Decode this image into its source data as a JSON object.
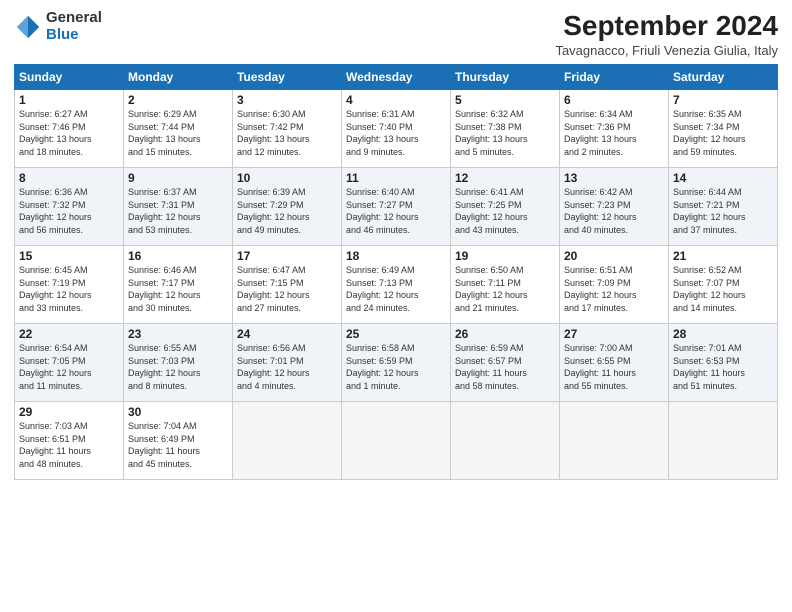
{
  "header": {
    "logo_general": "General",
    "logo_blue": "Blue",
    "month_title": "September 2024",
    "location": "Tavagnacco, Friuli Venezia Giulia, Italy"
  },
  "weekdays": [
    "Sunday",
    "Monday",
    "Tuesday",
    "Wednesday",
    "Thursday",
    "Friday",
    "Saturday"
  ],
  "weeks": [
    [
      {
        "day": "1",
        "info": "Sunrise: 6:27 AM\nSunset: 7:46 PM\nDaylight: 13 hours\nand 18 minutes."
      },
      {
        "day": "2",
        "info": "Sunrise: 6:29 AM\nSunset: 7:44 PM\nDaylight: 13 hours\nand 15 minutes."
      },
      {
        "day": "3",
        "info": "Sunrise: 6:30 AM\nSunset: 7:42 PM\nDaylight: 13 hours\nand 12 minutes."
      },
      {
        "day": "4",
        "info": "Sunrise: 6:31 AM\nSunset: 7:40 PM\nDaylight: 13 hours\nand 9 minutes."
      },
      {
        "day": "5",
        "info": "Sunrise: 6:32 AM\nSunset: 7:38 PM\nDaylight: 13 hours\nand 5 minutes."
      },
      {
        "day": "6",
        "info": "Sunrise: 6:34 AM\nSunset: 7:36 PM\nDaylight: 13 hours\nand 2 minutes."
      },
      {
        "day": "7",
        "info": "Sunrise: 6:35 AM\nSunset: 7:34 PM\nDaylight: 12 hours\nand 59 minutes."
      }
    ],
    [
      {
        "day": "8",
        "info": "Sunrise: 6:36 AM\nSunset: 7:32 PM\nDaylight: 12 hours\nand 56 minutes."
      },
      {
        "day": "9",
        "info": "Sunrise: 6:37 AM\nSunset: 7:31 PM\nDaylight: 12 hours\nand 53 minutes."
      },
      {
        "day": "10",
        "info": "Sunrise: 6:39 AM\nSunset: 7:29 PM\nDaylight: 12 hours\nand 49 minutes."
      },
      {
        "day": "11",
        "info": "Sunrise: 6:40 AM\nSunset: 7:27 PM\nDaylight: 12 hours\nand 46 minutes."
      },
      {
        "day": "12",
        "info": "Sunrise: 6:41 AM\nSunset: 7:25 PM\nDaylight: 12 hours\nand 43 minutes."
      },
      {
        "day": "13",
        "info": "Sunrise: 6:42 AM\nSunset: 7:23 PM\nDaylight: 12 hours\nand 40 minutes."
      },
      {
        "day": "14",
        "info": "Sunrise: 6:44 AM\nSunset: 7:21 PM\nDaylight: 12 hours\nand 37 minutes."
      }
    ],
    [
      {
        "day": "15",
        "info": "Sunrise: 6:45 AM\nSunset: 7:19 PM\nDaylight: 12 hours\nand 33 minutes."
      },
      {
        "day": "16",
        "info": "Sunrise: 6:46 AM\nSunset: 7:17 PM\nDaylight: 12 hours\nand 30 minutes."
      },
      {
        "day": "17",
        "info": "Sunrise: 6:47 AM\nSunset: 7:15 PM\nDaylight: 12 hours\nand 27 minutes."
      },
      {
        "day": "18",
        "info": "Sunrise: 6:49 AM\nSunset: 7:13 PM\nDaylight: 12 hours\nand 24 minutes."
      },
      {
        "day": "19",
        "info": "Sunrise: 6:50 AM\nSunset: 7:11 PM\nDaylight: 12 hours\nand 21 minutes."
      },
      {
        "day": "20",
        "info": "Sunrise: 6:51 AM\nSunset: 7:09 PM\nDaylight: 12 hours\nand 17 minutes."
      },
      {
        "day": "21",
        "info": "Sunrise: 6:52 AM\nSunset: 7:07 PM\nDaylight: 12 hours\nand 14 minutes."
      }
    ],
    [
      {
        "day": "22",
        "info": "Sunrise: 6:54 AM\nSunset: 7:05 PM\nDaylight: 12 hours\nand 11 minutes."
      },
      {
        "day": "23",
        "info": "Sunrise: 6:55 AM\nSunset: 7:03 PM\nDaylight: 12 hours\nand 8 minutes."
      },
      {
        "day": "24",
        "info": "Sunrise: 6:56 AM\nSunset: 7:01 PM\nDaylight: 12 hours\nand 4 minutes."
      },
      {
        "day": "25",
        "info": "Sunrise: 6:58 AM\nSunset: 6:59 PM\nDaylight: 12 hours\nand 1 minute."
      },
      {
        "day": "26",
        "info": "Sunrise: 6:59 AM\nSunset: 6:57 PM\nDaylight: 11 hours\nand 58 minutes."
      },
      {
        "day": "27",
        "info": "Sunrise: 7:00 AM\nSunset: 6:55 PM\nDaylight: 11 hours\nand 55 minutes."
      },
      {
        "day": "28",
        "info": "Sunrise: 7:01 AM\nSunset: 6:53 PM\nDaylight: 11 hours\nand 51 minutes."
      }
    ],
    [
      {
        "day": "29",
        "info": "Sunrise: 7:03 AM\nSunset: 6:51 PM\nDaylight: 11 hours\nand 48 minutes."
      },
      {
        "day": "30",
        "info": "Sunrise: 7:04 AM\nSunset: 6:49 PM\nDaylight: 11 hours\nand 45 minutes."
      },
      {
        "day": "",
        "info": ""
      },
      {
        "day": "",
        "info": ""
      },
      {
        "day": "",
        "info": ""
      },
      {
        "day": "",
        "info": ""
      },
      {
        "day": "",
        "info": ""
      }
    ]
  ]
}
